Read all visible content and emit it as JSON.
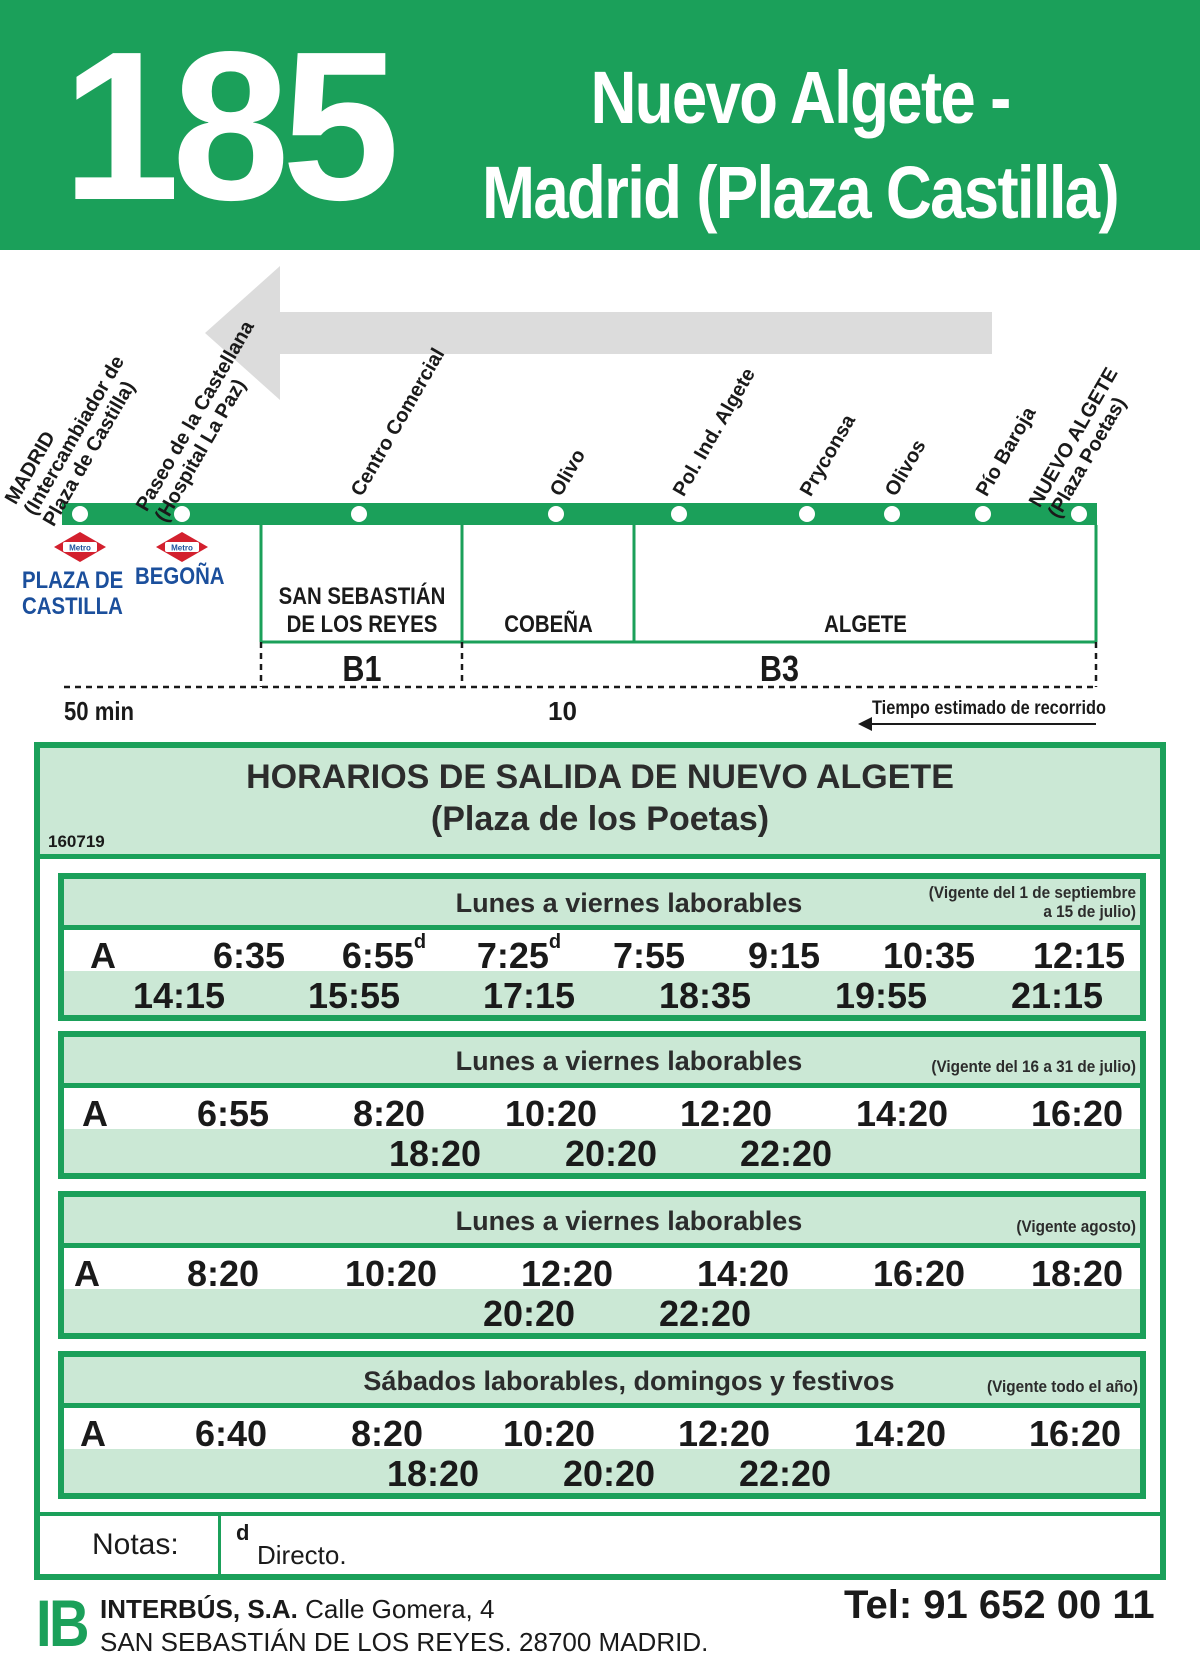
{
  "header": {
    "line_number": "185",
    "route_line1": "Nuevo Algete -",
    "route_line2": "Madrid (Plaza Castilla)"
  },
  "stops": [
    {
      "line1": "MADRID",
      "line2": "(Intercambiador de",
      "line3": "Plaza de Castilla)"
    },
    {
      "line1": "Paseo de la Castellana",
      "line2": "(Hospital La Paz)"
    },
    {
      "line1": "Centro Comercial"
    },
    {
      "line1": "Olivo"
    },
    {
      "line1": "Pol. Ind. Algete"
    },
    {
      "line1": "Pryconsa"
    },
    {
      "line1": "Olivos"
    },
    {
      "line1": "Pío Baroja"
    },
    {
      "line1": "NUEVO ALGETE",
      "line2": "(Plaza Poetas)"
    }
  ],
  "metro": [
    {
      "badge": "Metro",
      "line1": "PLAZA DE",
      "line2": "CASTILLA"
    },
    {
      "badge": "Metro",
      "line1": "BEGOÑA"
    }
  ],
  "zones": [
    {
      "line1": "SAN SEBASTIÁN",
      "line2": "DE LOS REYES"
    },
    {
      "line1": "COBEÑA"
    },
    {
      "line1": "ALGETE"
    }
  ],
  "fares": [
    "B1",
    "B3"
  ],
  "travel_time": {
    "total": "50 min",
    "partial": "10",
    "legend": "Tiempo estimado de recorrido"
  },
  "schedule": {
    "title_line1": "HORARIOS DE SALIDA DE NUEVO ALGETE",
    "title_line2": "(Plaza de los Poetas)",
    "code": "160719",
    "blocks": [
      {
        "day": "Lunes a viernes laborables",
        "validity_line1": "(Vigente del 1 de septiembre",
        "validity_line2": "a 15 de julio)",
        "marker": "A",
        "row1": [
          "6:35",
          "6:55",
          "7:25",
          "7:55",
          "9:15",
          "10:35",
          "12:15"
        ],
        "row1_notes": [
          "",
          "d",
          "d",
          "",
          "",
          "",
          ""
        ],
        "row2": [
          "14:15",
          "15:55",
          "17:15",
          "18:35",
          "19:55",
          "21:15"
        ]
      },
      {
        "day": "Lunes a viernes laborables",
        "validity_line1": "(Vigente del 16 a 31 de julio)",
        "marker": "A",
        "row1": [
          "6:55",
          "8:20",
          "10:20",
          "12:20",
          "14:20",
          "16:20"
        ],
        "row2": [
          "18:20",
          "20:20",
          "22:20"
        ]
      },
      {
        "day": "Lunes a viernes laborables",
        "validity_line1": "(Vigente agosto)",
        "marker": "A",
        "row1": [
          "8:20",
          "10:20",
          "12:20",
          "14:20",
          "16:20",
          "18:20"
        ],
        "row2": [
          "20:20",
          "22:20"
        ]
      },
      {
        "day": "Sábados laborables, domingos y festivos",
        "validity_line1": "(Vigente todo el año)",
        "marker": "A",
        "row1": [
          "6:40",
          "8:20",
          "10:20",
          "12:20",
          "14:20",
          "16:20"
        ],
        "row2": [
          "18:20",
          "20:20",
          "22:20"
        ]
      }
    ]
  },
  "notes": {
    "label": "Notas:",
    "symbol": "d",
    "text": "Directo."
  },
  "footer": {
    "logo": "IB",
    "company": "INTERBÚS, S.A.",
    "address1": "Calle Gomera, 4",
    "address2": "SAN SEBASTIÁN DE LOS REYES. 28700 MADRID.",
    "phone": "Tel: 91 652 00 11"
  },
  "colors": {
    "brand_green": "#1ba05a",
    "light_green": "#cbe8d5",
    "metro_red": "#d3202e",
    "metro_blue": "#1b4f9c"
  }
}
